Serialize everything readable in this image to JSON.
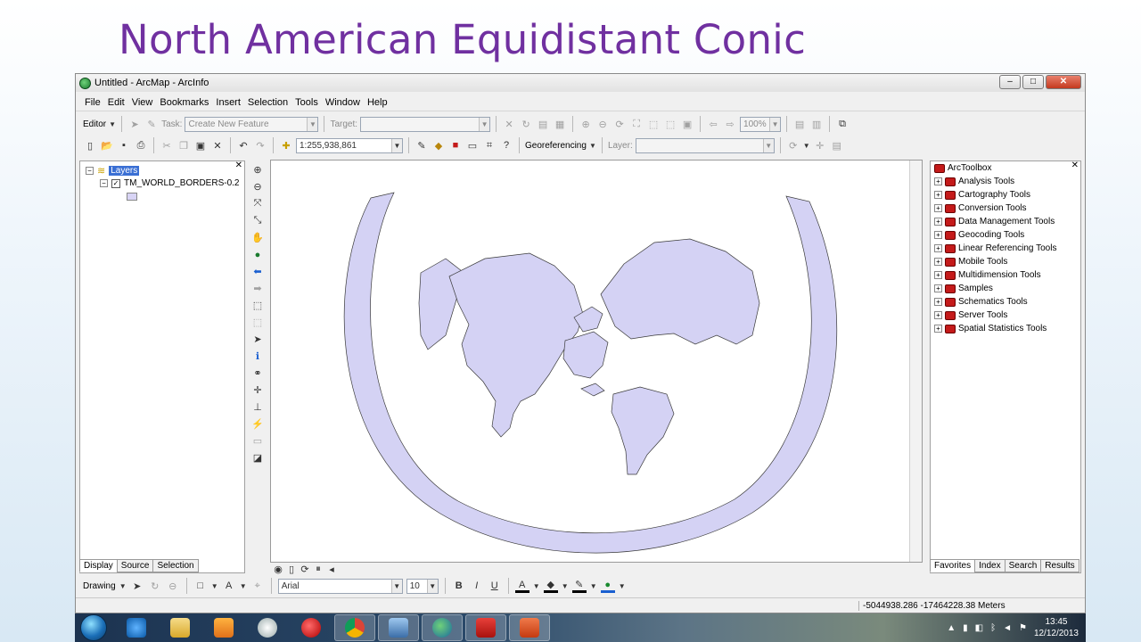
{
  "slide": {
    "title": "North American Equidistant Conic"
  },
  "window": {
    "title": "Untitled - ArcMap - ArcInfo",
    "minimize": "–",
    "maximize": "□",
    "close": "✕"
  },
  "menu": [
    "File",
    "Edit",
    "View",
    "Bookmarks",
    "Insert",
    "Selection",
    "Tools",
    "Window",
    "Help"
  ],
  "editor_toolbar": {
    "editor_label": "Editor",
    "task_label": "Task:",
    "task_value": "Create New Feature",
    "target_label": "Target:",
    "target_value": "",
    "zoom_value": "100%"
  },
  "standard_toolbar": {
    "scale_value": "1:255,938,861",
    "georeferencing_label": "Georeferencing",
    "layer_label": "Layer:",
    "layer_value": ""
  },
  "toc": {
    "root_label": "Layers",
    "layer_name": "TM_WORLD_BORDERS-0.2",
    "layer_checked": true,
    "tabs": [
      "Display",
      "Source",
      "Selection"
    ]
  },
  "toolbox": {
    "root_label": "ArcToolbox",
    "items": [
      "Analysis Tools",
      "Cartography Tools",
      "Conversion Tools",
      "Data Management Tools",
      "Geocoding Tools",
      "Linear Referencing Tools",
      "Mobile Tools",
      "Multidimension Tools",
      "Samples",
      "Schematics Tools",
      "Server Tools",
      "Spatial Statistics Tools"
    ],
    "tabs": [
      "Favorites",
      "Index",
      "Search",
      "Results"
    ]
  },
  "drawing_toolbar": {
    "drawing_label": "Drawing",
    "font_value": "Arial",
    "font_size_value": "10",
    "bold": "B",
    "italic": "I",
    "underline": "U",
    "font_color": "A"
  },
  "status": {
    "coordinates": "-5044938.286  -17464228.38 Meters"
  },
  "taskbar": {
    "time": "13:45",
    "date": "12/12/2013"
  },
  "colors": {
    "land_fill": "#d4d2f4",
    "land_stroke": "#3a3a3a",
    "title": "#7030a0",
    "selection": "#3a6fd4"
  },
  "icons": [
    "search-icon",
    "zoom-in-icon",
    "zoom-out-icon",
    "pan-icon",
    "globe-icon",
    "back-arrow-icon",
    "forward-arrow-icon",
    "select-arrow-icon",
    "identify-icon",
    "find-binoculars-icon"
  ]
}
